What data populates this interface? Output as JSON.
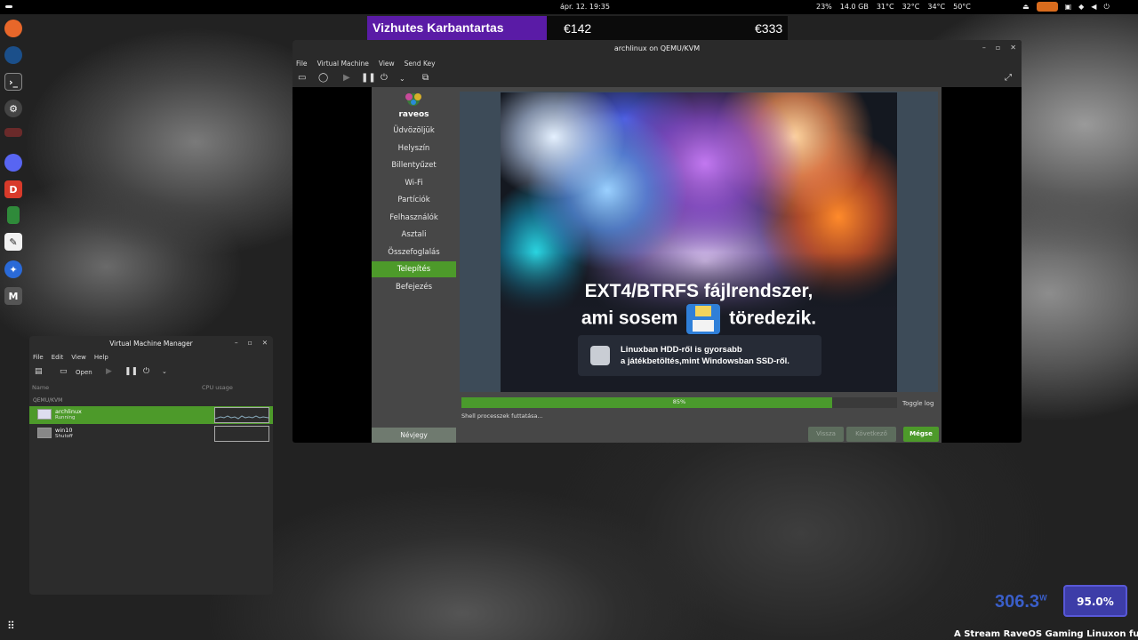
{
  "topbar": {
    "clock": "ápr. 12. 19:35",
    "battery": "23%",
    "memory": "14.0 GB",
    "temp1": "31°C",
    "temp2": "32°C",
    "temp3": "34°C",
    "temp4": "50°C"
  },
  "overlay": {
    "name": "Vizhutes Karbantartas",
    "value1": "€142",
    "value2": "€333"
  },
  "qemu": {
    "title": "archlinux on QEMU/KVM",
    "menu": [
      "File",
      "Virtual Machine",
      "View",
      "Send Key"
    ]
  },
  "installer": {
    "logo": "raveos",
    "steps": [
      "Üdvözöljük",
      "Helyszín",
      "Billentyűzet",
      "Wi-Fi",
      "Partíciók",
      "Felhasználók",
      "Asztali",
      "Összefoglalás",
      "Telepítés",
      "Befejezés"
    ],
    "active_step": "Telepítés",
    "about_button": "Névjegy",
    "slide": {
      "headline_line1": "EXT4/BTRFS fájlrendszer,",
      "headline_line2_pre": "ami sosem",
      "headline_line2_post": "töredezik.",
      "info_line1": "Linuxban HDD-ről is gyorsabb",
      "info_line2": "a játékbetöltés,mint Windowsban SSD-ről."
    },
    "progress": {
      "value": 85,
      "label": "85%"
    },
    "toggle_log": "Toggle log",
    "status": "Shell processzek futtatása...",
    "buttons": {
      "back": "Vissza",
      "next": "Következő",
      "cancel": "Mégse"
    }
  },
  "vmm": {
    "title": "Virtual Machine Manager",
    "menu": [
      "File",
      "Edit",
      "View",
      "Help"
    ],
    "open_label": "Open",
    "col_name": "Name",
    "col_cpu": "CPU usage",
    "group": "QEMU/KVM",
    "vms": [
      {
        "name": "archlinux",
        "state": "Running"
      },
      {
        "name": "win10",
        "state": "Shutoff"
      }
    ]
  },
  "stats": {
    "power": "306.3",
    "power_unit": "W",
    "usage": "95.0%"
  },
  "ticker": "A Stream RaveOS Gaming Linuxon fut"
}
